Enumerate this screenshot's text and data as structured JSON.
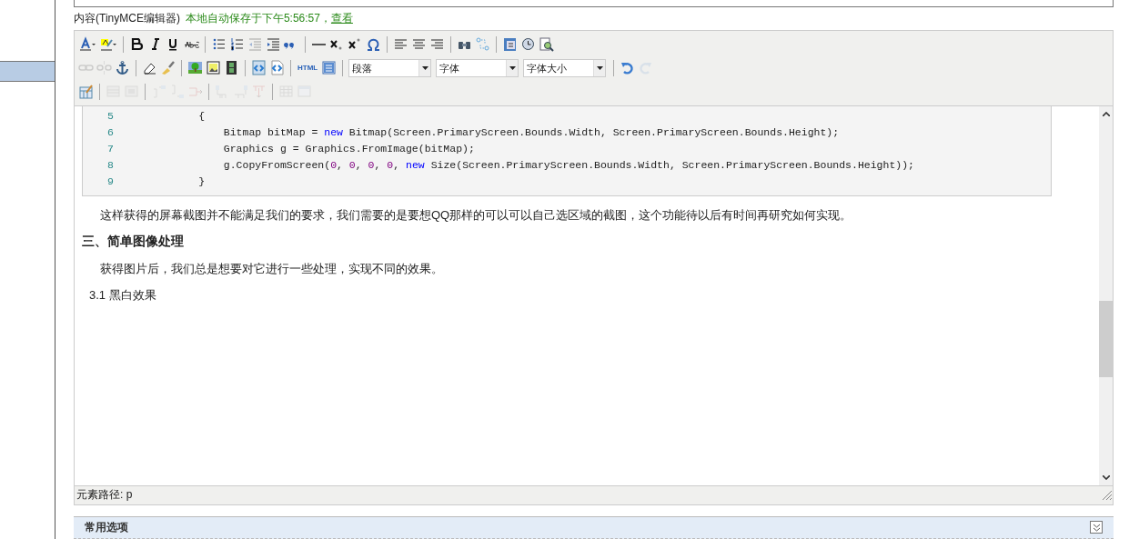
{
  "sidebar": {
    "items": [
      {
        "selected": true
      }
    ]
  },
  "field_label": {
    "label": "内容",
    "note": "(TinyMCE编辑器)",
    "autosave": "本地自动保存于下午5:56:57，",
    "link": "查看"
  },
  "toolbar": {
    "rows": [
      [
        {
          "kind": "button",
          "disabled": false
        },
        {
          "kind": "button",
          "disabled": false
        },
        {
          "kind": "sep"
        },
        {
          "kind": "button",
          "disabled": false
        },
        {
          "kind": "button",
          "disabled": false
        },
        {
          "kind": "button",
          "disabled": false
        },
        {
          "kind": "button",
          "disabled": false
        },
        {
          "kind": "sep"
        },
        {
          "kind": "button",
          "disabled": false
        },
        {
          "kind": "button",
          "disabled": false
        },
        {
          "kind": "button",
          "disabled": true
        },
        {
          "kind": "button",
          "disabled": false
        },
        {
          "kind": "button",
          "disabled": false
        },
        {
          "kind": "sep"
        },
        {
          "kind": "button",
          "disabled": false
        },
        {
          "kind": "button",
          "disabled": false
        },
        {
          "kind": "button",
          "disabled": false
        },
        {
          "kind": "button",
          "disabled": false
        },
        {
          "kind": "sep"
        },
        {
          "kind": "button",
          "disabled": false
        },
        {
          "kind": "button",
          "disabled": false
        },
        {
          "kind": "button",
          "disabled": false
        },
        {
          "kind": "sep"
        },
        {
          "kind": "button",
          "disabled": false
        },
        {
          "kind": "button",
          "disabled": false
        },
        {
          "kind": "sep"
        },
        {
          "kind": "button",
          "disabled": false
        },
        {
          "kind": "button",
          "disabled": false
        },
        {
          "kind": "button",
          "disabled": false
        }
      ],
      [
        {
          "kind": "button",
          "disabled": true
        },
        {
          "kind": "button",
          "disabled": true
        },
        {
          "kind": "button",
          "disabled": false
        },
        {
          "kind": "sep"
        },
        {
          "kind": "button",
          "disabled": false
        },
        {
          "kind": "button",
          "disabled": false
        },
        {
          "kind": "sep"
        },
        {
          "kind": "button",
          "disabled": false
        },
        {
          "kind": "button",
          "disabled": false
        },
        {
          "kind": "button",
          "disabled": false
        },
        {
          "kind": "sep"
        },
        {
          "kind": "button",
          "disabled": false
        },
        {
          "kind": "button",
          "disabled": false
        },
        {
          "kind": "sep"
        },
        {
          "kind": "text",
          "label": "HTML",
          "disabled": false
        },
        {
          "kind": "button",
          "disabled": false
        },
        {
          "kind": "sep"
        },
        {
          "kind": "select",
          "value": "段落"
        },
        {
          "kind": "select",
          "value": "字体"
        },
        {
          "kind": "select",
          "value": "字体大小"
        },
        {
          "kind": "sep"
        },
        {
          "kind": "button",
          "disabled": false
        },
        {
          "kind": "button",
          "disabled": true
        }
      ],
      [
        {
          "kind": "button",
          "disabled": false
        },
        {
          "kind": "sep"
        },
        {
          "kind": "button",
          "disabled": true
        },
        {
          "kind": "button",
          "disabled": true
        },
        {
          "kind": "sep"
        },
        {
          "kind": "button",
          "disabled": true
        },
        {
          "kind": "button",
          "disabled": true
        },
        {
          "kind": "button",
          "disabled": true
        },
        {
          "kind": "sep"
        },
        {
          "kind": "button",
          "disabled": true
        },
        {
          "kind": "button",
          "disabled": true
        },
        {
          "kind": "button",
          "disabled": true
        },
        {
          "kind": "sep"
        },
        {
          "kind": "button",
          "disabled": true
        },
        {
          "kind": "button",
          "disabled": true
        }
      ]
    ]
  },
  "code_block": {
    "lines": [
      {
        "number": "5",
        "tokens": [
          {
            "kind": "plain",
            "text": "        {"
          }
        ]
      },
      {
        "number": "6",
        "tokens": [
          {
            "kind": "plain",
            "text": "            Bitmap bitMap = "
          },
          {
            "kind": "keyword",
            "text": "new"
          },
          {
            "kind": "plain",
            "text": " Bitmap(Screen.PrimaryScreen.Bounds.Width, Screen.PrimaryScreen.Bounds.Height);"
          }
        ]
      },
      {
        "number": "7",
        "tokens": [
          {
            "kind": "plain",
            "text": "            Graphics g = Graphics.FromImage(bitMap);"
          }
        ]
      },
      {
        "number": "8",
        "tokens": [
          {
            "kind": "plain",
            "text": "            g.CopyFromScreen("
          },
          {
            "kind": "number",
            "text": "0"
          },
          {
            "kind": "plain",
            "text": ", "
          },
          {
            "kind": "number",
            "text": "0"
          },
          {
            "kind": "plain",
            "text": ", "
          },
          {
            "kind": "number",
            "text": "0"
          },
          {
            "kind": "plain",
            "text": ", "
          },
          {
            "kind": "number",
            "text": "0"
          },
          {
            "kind": "plain",
            "text": ", "
          },
          {
            "kind": "keyword",
            "text": "new"
          },
          {
            "kind": "plain",
            "text": " Size(Screen.PrimaryScreen.Bounds.Width, Screen.PrimaryScreen.Bounds.Height));"
          }
        ]
      },
      {
        "number": "9",
        "tokens": [
          {
            "kind": "plain",
            "text": "        }"
          }
        ]
      }
    ]
  },
  "content": [
    {
      "kind": "paragraph",
      "text": "这样获得的屏幕截图并不能满足我们的要求，我们需要的是要想QQ那样的可以可以自己选区域的截图，这个功能待以后有时间再研究如何实现。"
    },
    {
      "kind": "heading",
      "text": "三、简单图像处理"
    },
    {
      "kind": "paragraph",
      "text": "获得图片后，我们总是想要对它进行一些处理，实现不同的效果。"
    },
    {
      "kind": "subheading",
      "text": "3.1 黑白效果"
    }
  ],
  "status_bar": {
    "path": "元素路径: p"
  },
  "section": {
    "title": "常用选项",
    "expanded": false
  }
}
